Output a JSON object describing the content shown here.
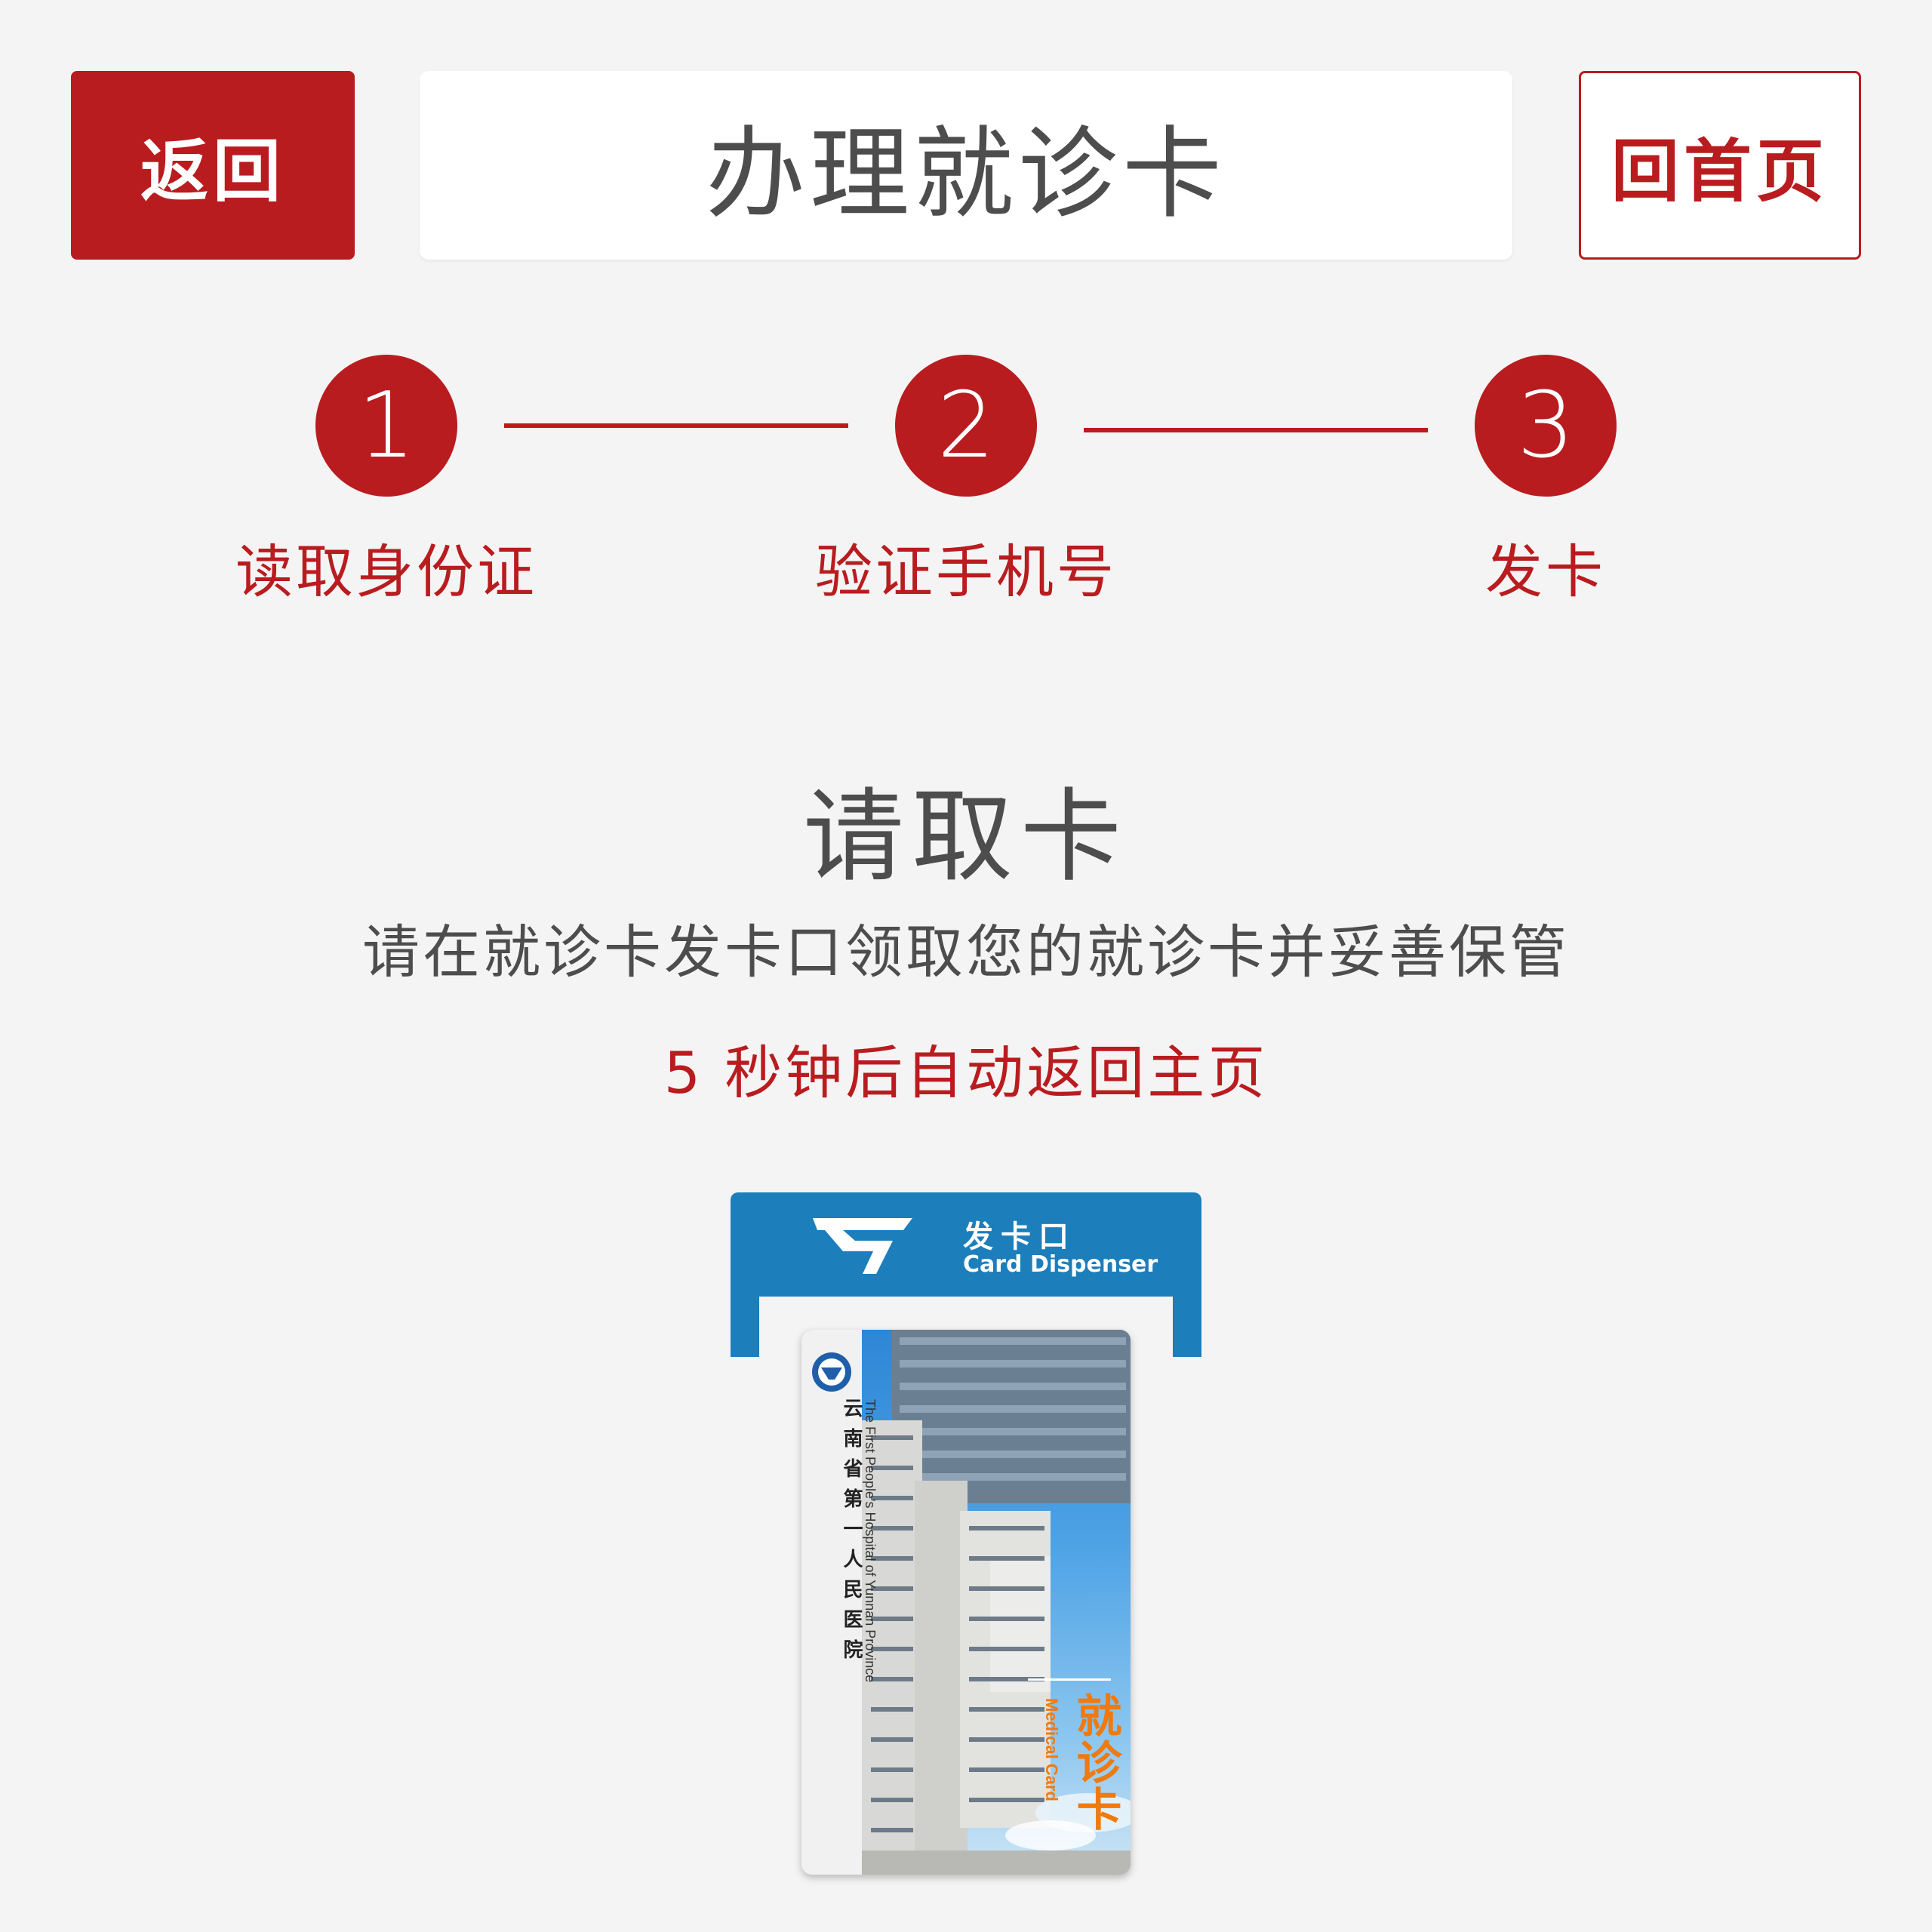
{
  "header": {
    "back_label": "返回",
    "title": "办理就诊卡",
    "home_label": "回首页"
  },
  "steps": [
    {
      "number": "1",
      "label": "读取身份证"
    },
    {
      "number": "2",
      "label": "验证手机号"
    },
    {
      "number": "3",
      "label": "发卡"
    }
  ],
  "main": {
    "title": "请取卡",
    "subtitle": "请在就诊卡发卡口领取您的就诊卡并妥善保管",
    "countdown": "5  秒钟后自动返回主页"
  },
  "dispenser": {
    "label_cn": "发卡口",
    "label_en": "Card Dispenser"
  },
  "card": {
    "hospital_cn": "云南省第一人民医院",
    "hospital_en": "The First People's Hospital of Yunnan Province",
    "title_cn": "就诊卡",
    "title_en": "Medical Card"
  },
  "colors": {
    "accent": "#b91c1f",
    "background": "#f4f4f4",
    "text": "#4d4d4d",
    "dispenser": "#1c7ebb",
    "card_label": "#ef7a10"
  }
}
